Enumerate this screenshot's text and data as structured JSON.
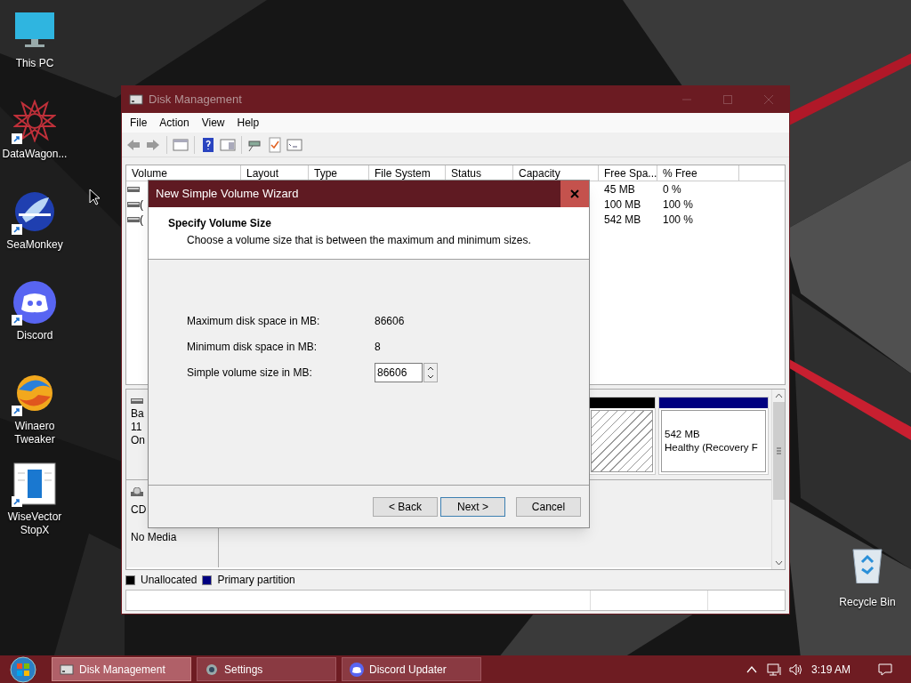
{
  "desktop_icons": [
    {
      "label": "This PC",
      "kind": "monitor",
      "shortcut": false
    },
    {
      "label": "DataWagon...",
      "kind": "star",
      "shortcut": true
    },
    {
      "label": "SeaMonkey",
      "kind": "bird",
      "shortcut": true
    },
    {
      "label": "Discord",
      "kind": "chat",
      "shortcut": true
    },
    {
      "label": "Winaero Tweaker",
      "kind": "swirl",
      "shortcut": true
    },
    {
      "label": "WiseVector StopX",
      "kind": "document",
      "shortcut": true
    }
  ],
  "recycle_bin": {
    "label": "Recycle Bin"
  },
  "window": {
    "title": "Disk Management",
    "menu": [
      "File",
      "Action",
      "View",
      "Help"
    ],
    "volume_list": {
      "columns": [
        "Volume",
        "Layout",
        "Type",
        "File System",
        "Status",
        "Capacity",
        "Free Spa...",
        "% Free"
      ],
      "rows": [
        {
          "free_space": "45 MB",
          "percent_free": "0 %"
        },
        {
          "volume": "(",
          "free_space": "100 MB",
          "percent_free": "100 %"
        },
        {
          "volume": "(",
          "free_space": "542 MB",
          "percent_free": "100 %"
        }
      ]
    },
    "disks": [
      {
        "kind": "disk",
        "lines": [
          "Ba",
          "11",
          "On"
        ],
        "partitions": [
          {
            "color": "#000000",
            "hatched": true
          },
          {
            "color": "#000080",
            "hatched": false,
            "lines": [
              "542 MB",
              "Healthy (Recovery F"
            ]
          }
        ]
      },
      {
        "kind": "cdrom",
        "lines": [
          "CD",
          "No Media"
        ]
      }
    ],
    "legend": [
      {
        "label": "Unallocated",
        "color": "#000000"
      },
      {
        "label": "Primary partition",
        "color": "#000080"
      }
    ]
  },
  "dialog": {
    "title": "New Simple Volume Wizard",
    "heading": "Specify Volume Size",
    "subheading": "Choose a volume size that is between the maximum and minimum sizes.",
    "fields": [
      {
        "kind": "text",
        "label": "Maximum disk space in MB:",
        "value": "86606"
      },
      {
        "kind": "text",
        "label": "Minimum disk space in MB:",
        "value": "8"
      },
      {
        "kind": "spinner",
        "label": "Simple volume size in MB:",
        "value": "86606"
      }
    ],
    "buttons": [
      {
        "label": "< Back",
        "default": false
      },
      {
        "label": "Next >",
        "default": true
      },
      {
        "label": "Cancel",
        "default": false
      }
    ]
  },
  "taskbar": {
    "tasks": [
      {
        "label": "Disk Management",
        "kind": "disk",
        "selected": true
      },
      {
        "label": "Settings",
        "kind": "gear",
        "selected": false
      },
      {
        "label": "Discord Updater",
        "kind": "chat",
        "selected": false
      }
    ],
    "time": "3:19 AM"
  }
}
